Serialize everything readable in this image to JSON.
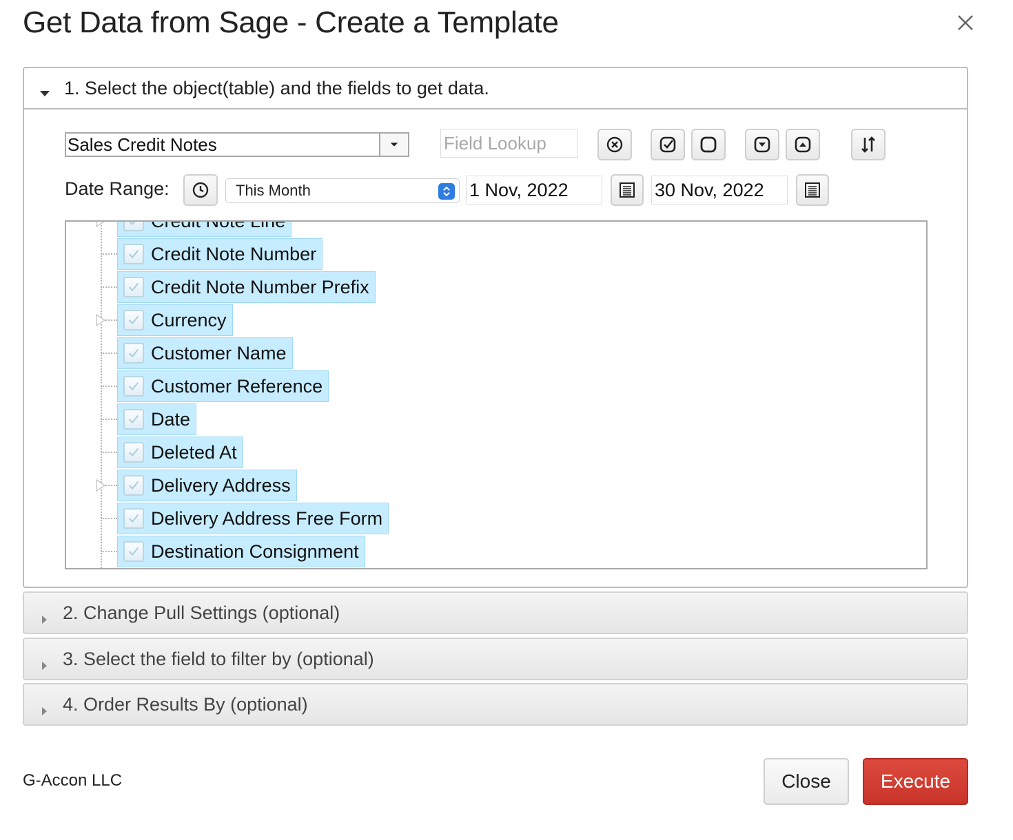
{
  "dialog": {
    "title": "Get Data from Sage - Create a Template"
  },
  "section1": {
    "header": "1. Select the object(table) and the fields to get data.",
    "object_select": {
      "value": "Sales Credit Notes"
    },
    "field_lookup": {
      "placeholder": "Field Lookup"
    },
    "date_range": {
      "label": "Date Range:",
      "preset": "This Month",
      "start": "1 Nov, 2022",
      "end": "30 Nov, 2022"
    },
    "tree_items": [
      {
        "label": "Credit Note Line",
        "checked": true,
        "expandable": true
      },
      {
        "label": "Credit Note Number",
        "checked": true,
        "expandable": false
      },
      {
        "label": "Credit Note Number Prefix",
        "checked": true,
        "expandable": false
      },
      {
        "label": "Currency",
        "checked": true,
        "expandable": true
      },
      {
        "label": "Customer Name",
        "checked": true,
        "expandable": false
      },
      {
        "label": "Customer Reference",
        "checked": true,
        "expandable": false
      },
      {
        "label": "Date",
        "checked": true,
        "expandable": false
      },
      {
        "label": "Deleted At",
        "checked": true,
        "expandable": false
      },
      {
        "label": "Delivery Address",
        "checked": true,
        "expandable": true
      },
      {
        "label": "Delivery Address Free Form",
        "checked": true,
        "expandable": false
      },
      {
        "label": "Destination Consignment",
        "checked": true,
        "expandable": false
      }
    ]
  },
  "section2": {
    "header": "2. Change Pull Settings (optional)"
  },
  "section3": {
    "header": "3. Select the field to filter by (optional)"
  },
  "section4": {
    "header": "4. Order Results By (optional)"
  },
  "footer": {
    "brand": "G-Accon LLC",
    "close_label": "Close",
    "execute_label": "Execute"
  },
  "colors": {
    "execute_bg": "#d03c31",
    "tree_selected_bg": "#c6ecff",
    "spinner_accent": "#2f7de1"
  }
}
